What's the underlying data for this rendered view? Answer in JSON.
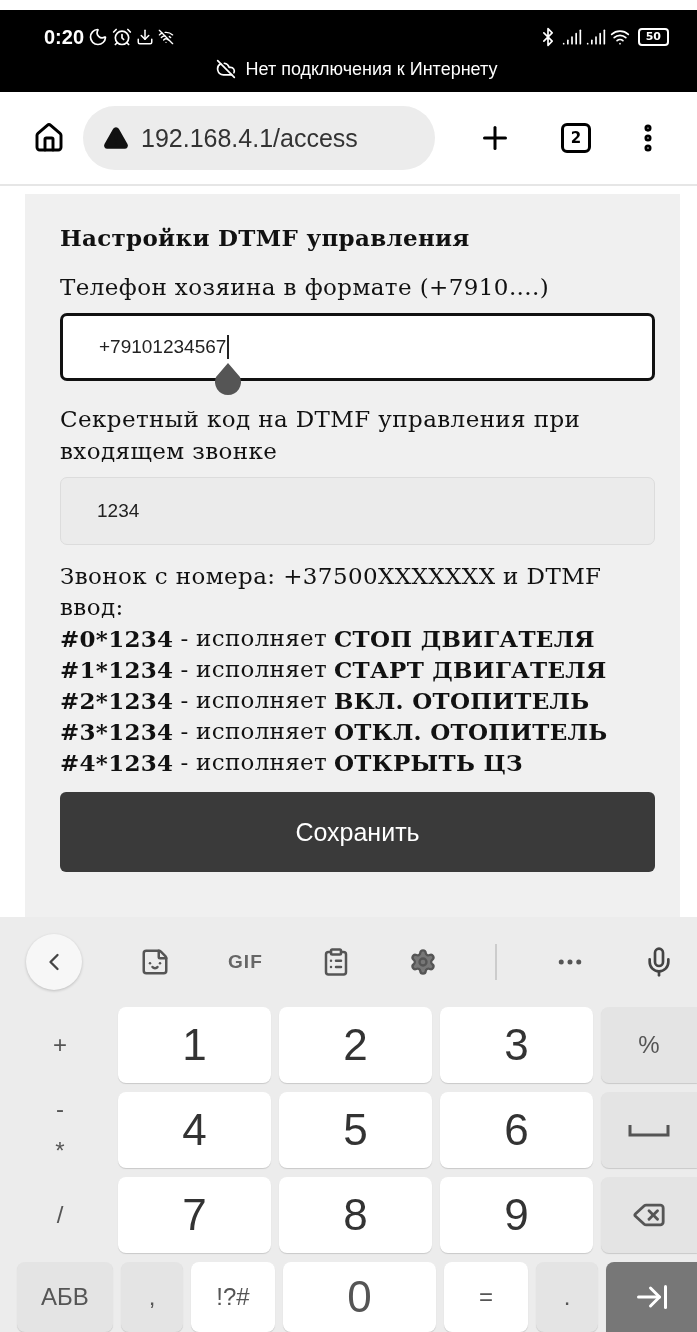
{
  "status_bar": {
    "time": "0:20",
    "battery": "50"
  },
  "banner": "Нет подключения к Интернету",
  "browser": {
    "url": "192.168.4.1/access",
    "tab_count": "2"
  },
  "form": {
    "title": "Настройки DTMF управления",
    "fields": [
      {
        "label": "Телефон хозяина в формате (+7910....)",
        "value": "+79101234567",
        "focused": true
      },
      {
        "label": "Секретный код на DTMF управления при входящем звонке",
        "value": "1234",
        "focused": false
      }
    ],
    "intro": "Звонок с номера: +37500XXXXXXX и DTMF ввод:",
    "commands": [
      {
        "code": "#0*1234",
        "verb": "- исполняет",
        "action": "СТОП ДВИГАТЕЛЯ"
      },
      {
        "code": "#1*1234",
        "verb": "- исполняет",
        "action": "СТАРТ ДВИГАТЕЛЯ"
      },
      {
        "code": "#2*1234",
        "verb": "- исполняет",
        "action": "ВКЛ. ОТОПИТЕЛЬ"
      },
      {
        "code": "#3*1234",
        "verb": "- исполняет",
        "action": "ОТКЛ. ОТОПИТЕЛЬ"
      },
      {
        "code": "#4*1234",
        "verb": "- исполняет",
        "action": "ОТКРЫТЬ ЦЗ"
      }
    ],
    "button": "Сохранить"
  },
  "keyboard": {
    "gif": "GIF",
    "rows": [
      {
        "side": [
          "+"
        ],
        "keys": [
          "1",
          "2",
          "3"
        ],
        "right": {
          "kind": "text",
          "label": "%"
        }
      },
      {
        "side": [
          "-",
          "*"
        ],
        "keys": [
          "4",
          "5",
          "6"
        ],
        "right": {
          "kind": "space"
        }
      },
      {
        "side": [
          "/"
        ],
        "keys": [
          "7",
          "8",
          "9"
        ],
        "right": {
          "kind": "backspace"
        }
      }
    ],
    "bottom": [
      {
        "kind": "function",
        "label": "АБВ"
      },
      {
        "kind": "function",
        "label": ","
      },
      {
        "kind": "key",
        "label": "!?#"
      },
      {
        "kind": "key",
        "label": "0"
      },
      {
        "kind": "key",
        "label": "="
      },
      {
        "kind": "function",
        "label": "."
      },
      {
        "kind": "enter"
      }
    ]
  }
}
